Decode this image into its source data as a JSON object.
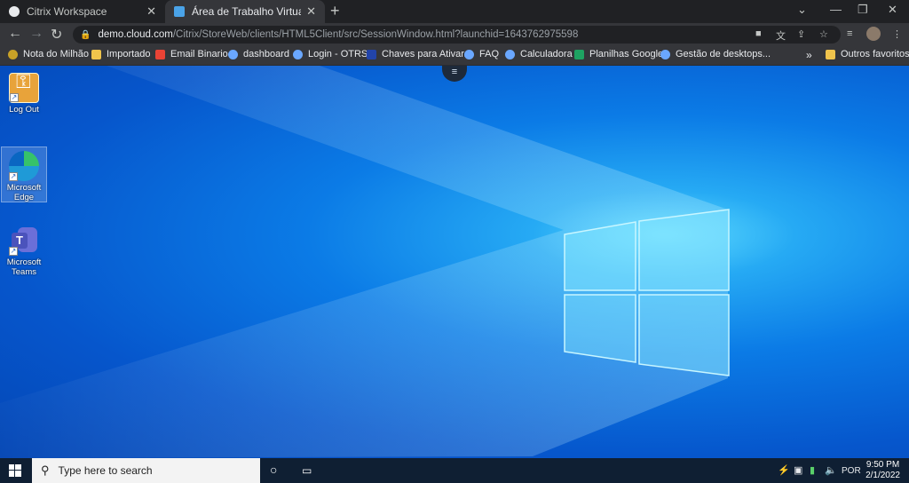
{
  "tabs": [
    {
      "title": "Citrix Workspace",
      "active": false
    },
    {
      "title": "Área de Trabalho Virtual do Azur",
      "active": true
    }
  ],
  "address": {
    "host": "demo.cloud.com",
    "path": "/Citrix/StoreWeb/clients/HTML5Client/src/SessionWindow.html?launchid=1643762975598"
  },
  "bookmarks": [
    {
      "label": "Nota do Milhão",
      "icon": "dollar-icon",
      "color": "#c9a227"
    },
    {
      "label": "Importado",
      "icon": "folder-icon",
      "color": "#f0c44c"
    },
    {
      "label": "Email Binario",
      "icon": "gmail-icon",
      "color": "#ea4335"
    },
    {
      "label": "dashboard",
      "icon": "b-icon",
      "color": "#6aa7ff"
    },
    {
      "label": "Login - OTRS",
      "icon": "b-icon",
      "color": "#6aa7ff"
    },
    {
      "label": "Chaves para Ativar...",
      "icon": "n-icon",
      "color": "#2244aa"
    },
    {
      "label": "FAQ",
      "icon": "b-icon",
      "color": "#6aa7ff"
    },
    {
      "label": "Calculadora",
      "icon": "b-icon",
      "color": "#6aa7ff"
    },
    {
      "label": "Planilhas Google",
      "icon": "sheets-icon",
      "color": "#1ea362"
    },
    {
      "label": "Gestão de desktops...",
      "icon": "b-icon",
      "color": "#6aa7ff"
    }
  ],
  "bookmarks_more": "»",
  "other_bookmarks": "Outros favoritos",
  "desktop_icons": [
    {
      "label": "Log Out"
    },
    {
      "label": "Microsoft Edge"
    },
    {
      "label": "Microsoft Teams"
    }
  ],
  "taskbar": {
    "search_placeholder": "Type here to search",
    "language": "POR",
    "time": "9:50 PM",
    "date": "2/1/2022"
  },
  "colors": {
    "desktop_accent": "#0b7be6",
    "taskbar": "#0f1f33",
    "chrome_bg": "#202124"
  }
}
